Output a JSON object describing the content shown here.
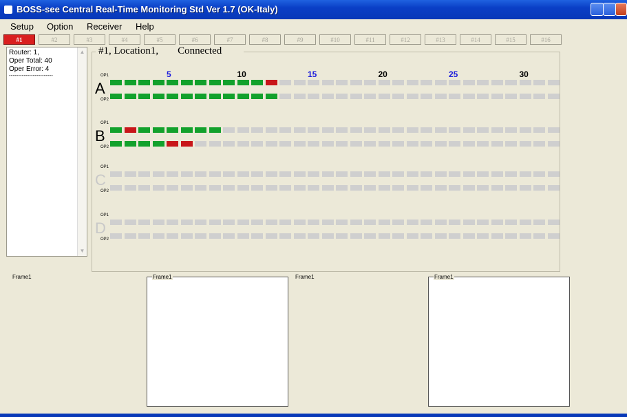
{
  "window": {
    "title": "BOSS-see Central Real-Time Monitoring Std Ver 1.7 (OK-Italy)"
  },
  "menu": [
    "Setup",
    "Option",
    "Receiver",
    "Help"
  ],
  "tabs": [
    "#1",
    "#2",
    "#3",
    "#4",
    "#5",
    "#6",
    "#7",
    "#8",
    "#9",
    "#10",
    "#11",
    "#12",
    "#13",
    "#14",
    "#15",
    "#16"
  ],
  "active_tab": 0,
  "info": [
    "Router: 1,",
    "Oper Total: 40",
    "Oper Error: 4",
    "------------------------"
  ],
  "main": {
    "router_label": "#1, Location1,",
    "status": "Connected"
  },
  "columns": [
    {
      "label": "5",
      "color": "#1a1adc"
    },
    {
      "label": "10",
      "color": "#000000"
    },
    {
      "label": "15",
      "color": "#1a1adc"
    },
    {
      "label": "20",
      "color": "#000000"
    },
    {
      "label": "25",
      "color": "#1a1adc"
    },
    {
      "label": "30",
      "color": "#000000"
    }
  ],
  "colors": {
    "ok": "#12a12c",
    "error": "#c8161a",
    "idle": "#cfcfcf",
    "active_tab": "#d91f1f"
  },
  "routers": [
    {
      "letter": "A",
      "enabled": true,
      "op1_label": "OP1",
      "op2_label": "OP2",
      "op1": "gggggggggggr",
      "op2": "gggggggggggg"
    },
    {
      "letter": "B",
      "enabled": true,
      "op1_label": "OP1",
      "op2_label": "OP2",
      "op1": "grgggggg",
      "op2": "ggggrr"
    },
    {
      "letter": "C",
      "enabled": false,
      "op1_label": "OP1",
      "op2_label": "OP2",
      "op1": "",
      "op2": ""
    },
    {
      "letter": "D",
      "enabled": false,
      "op1_label": "OP1",
      "op2_label": "OP2",
      "op1": "",
      "op2": ""
    }
  ],
  "frames": [
    "Frame1",
    "Frame1",
    "Frame1",
    "Frame1"
  ]
}
